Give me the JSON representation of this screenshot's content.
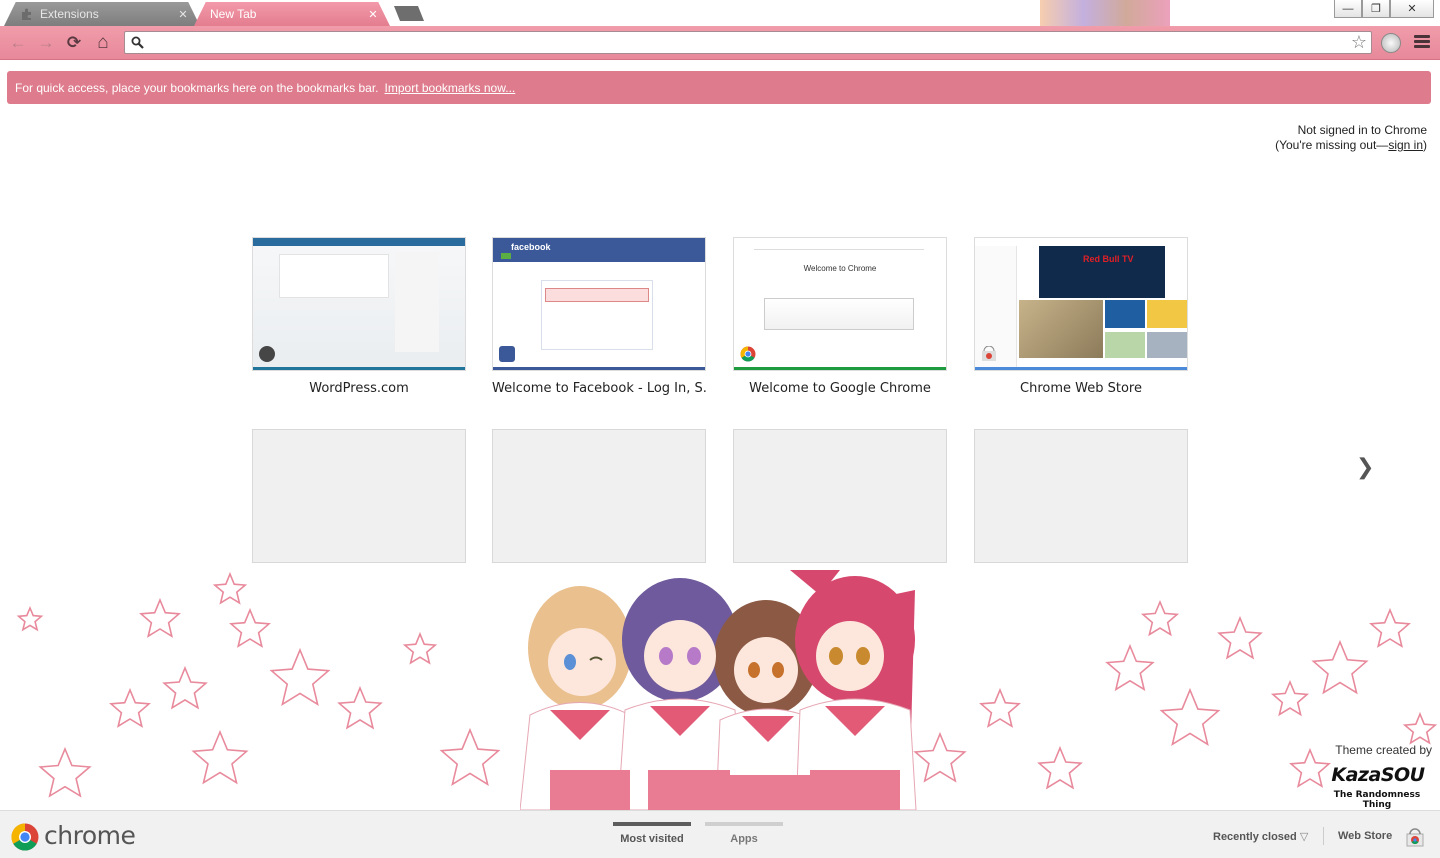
{
  "tabs": [
    {
      "title": "Extensions",
      "active": false
    },
    {
      "title": "New Tab",
      "active": true
    }
  ],
  "window_controls": {
    "minimize": "—",
    "restore": "❐",
    "close": "✕"
  },
  "toolbar": {
    "back_icon": "←",
    "forward_icon": "→",
    "reload_icon": "⟳",
    "home_icon": "⌂",
    "omnibox_value": "",
    "star_icon": "☆"
  },
  "bookmark_promo": {
    "text": "For quick access, place your bookmarks here on the bookmarks bar.",
    "link": "Import bookmarks now..."
  },
  "signin": {
    "line1": "Not signed in to Chrome",
    "line2_prefix": "(You're missing out—",
    "link": "sign in",
    "line2_suffix": ")"
  },
  "most_visited": [
    {
      "title": "WordPress.com",
      "strip_color": "#21759b"
    },
    {
      "title": "Welcome to Facebook - Log In, S...",
      "strip_color": "#3b5998",
      "thumb_header": "facebook"
    },
    {
      "title": "Welcome to Google Chrome",
      "strip_color": "#1e9b3f",
      "thumb_header": "Welcome to Chrome"
    },
    {
      "title": "Chrome Web Store",
      "strip_color": "#4a8ad8",
      "thumb_header": "Red Bull TV"
    }
  ],
  "next_page_icon": "❯",
  "theme_credit": {
    "label": "Theme created by",
    "author": "KazaSOU",
    "subtitle": "The Randomness Thing"
  },
  "footer": {
    "brand": "chrome",
    "tabs": [
      {
        "label": "Most visited",
        "active": true
      },
      {
        "label": "Apps",
        "active": false
      }
    ],
    "recently_closed": "Recently closed",
    "recently_closed_arrow": "▽",
    "web_store": "Web Store"
  },
  "colors": {
    "toolbar_pink": "#e98b9c",
    "promo_bar": "#de7b8c",
    "star_outline": "#e88a9c"
  }
}
